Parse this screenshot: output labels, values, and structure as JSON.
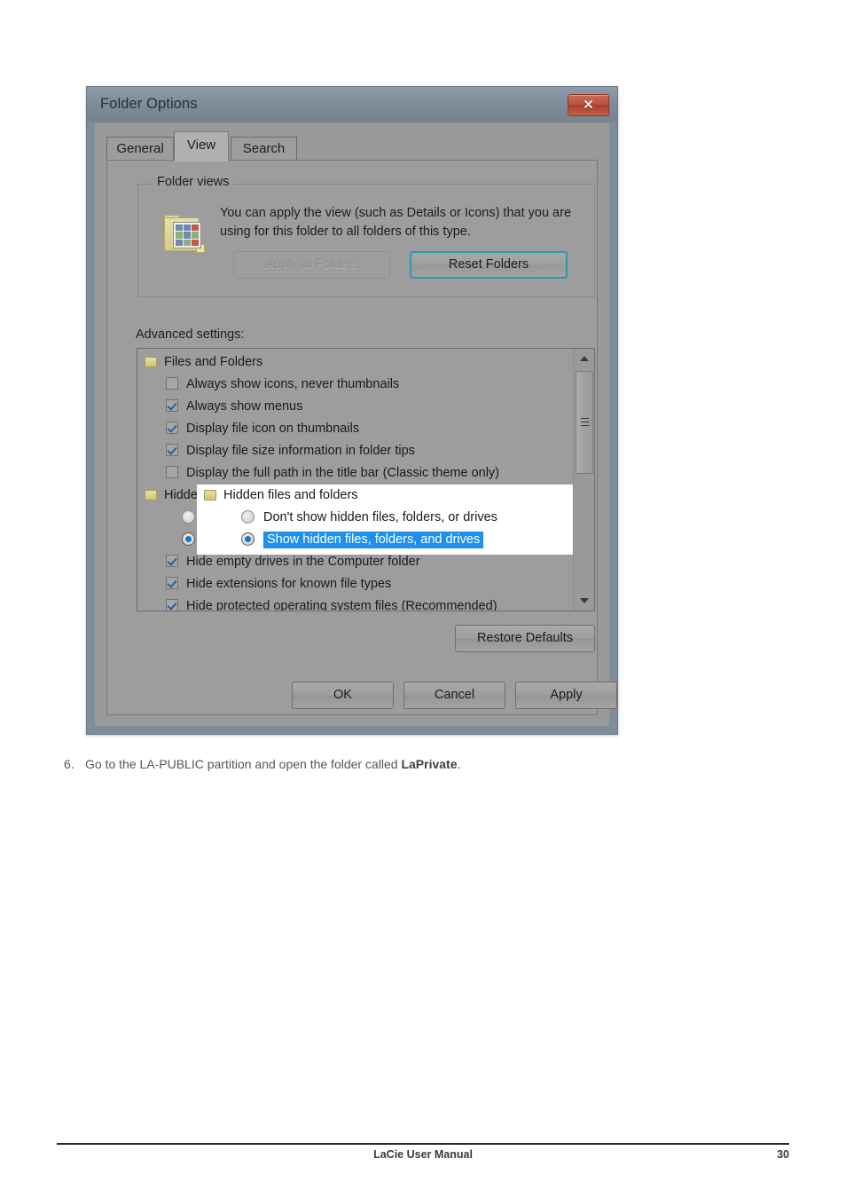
{
  "document": {
    "step": {
      "number": "6.",
      "text_before": "Go to the LA-PUBLIC partition and open the folder called ",
      "bold": "LaPrivate",
      "text_after": "."
    },
    "footer": {
      "title": "LaCie User Manual",
      "page": "30"
    }
  },
  "dialog": {
    "title": "Folder Options",
    "close_label": "✕",
    "tabs": [
      {
        "label": "General",
        "active": false
      },
      {
        "label": "View",
        "active": true
      },
      {
        "label": "Search",
        "active": false
      }
    ],
    "folder_views": {
      "legend": "Folder views",
      "description": "You can apply the view (such as Details or Icons) that you are using for this folder to all folders of this type.",
      "apply_button": "Apply to Folders",
      "reset_button": "Reset Folders"
    },
    "advanced": {
      "label": "Advanced settings:",
      "group_1": "Files and Folders",
      "items": [
        {
          "label": "Always show icons, never thumbnails",
          "checked": false
        },
        {
          "label": "Always show menus",
          "checked": true
        },
        {
          "label": "Display file icon on thumbnails",
          "checked": true
        },
        {
          "label": "Display file size information in folder tips",
          "checked": true
        },
        {
          "label": "Display the full path in the title bar (Classic theme only)",
          "checked": false
        }
      ],
      "group_2": "Hidden files and folders",
      "radios": [
        {
          "label": "Don't show hidden files, folders, or drives",
          "selected": false
        },
        {
          "label": "Show hidden files, folders, and drives",
          "selected": true
        }
      ],
      "items_after": [
        {
          "label": "Hide empty drives in the Computer folder",
          "checked": true
        },
        {
          "label": "Hide extensions for known file types",
          "checked": true
        },
        {
          "label": "Hide protected operating system files (Recommended)",
          "checked": true
        }
      ],
      "restore_button": "Restore Defaults"
    },
    "buttons": {
      "ok": "OK",
      "cancel": "Cancel",
      "apply": "Apply"
    }
  },
  "colors": {
    "titlebar": "#7e8c9a",
    "dialog_face": "#9d9d9d",
    "close_red": "#bb5440",
    "focus_ring": "#2d98ab",
    "selection_blue": "#1e90ef",
    "check_blue": "#2f5b9a"
  }
}
